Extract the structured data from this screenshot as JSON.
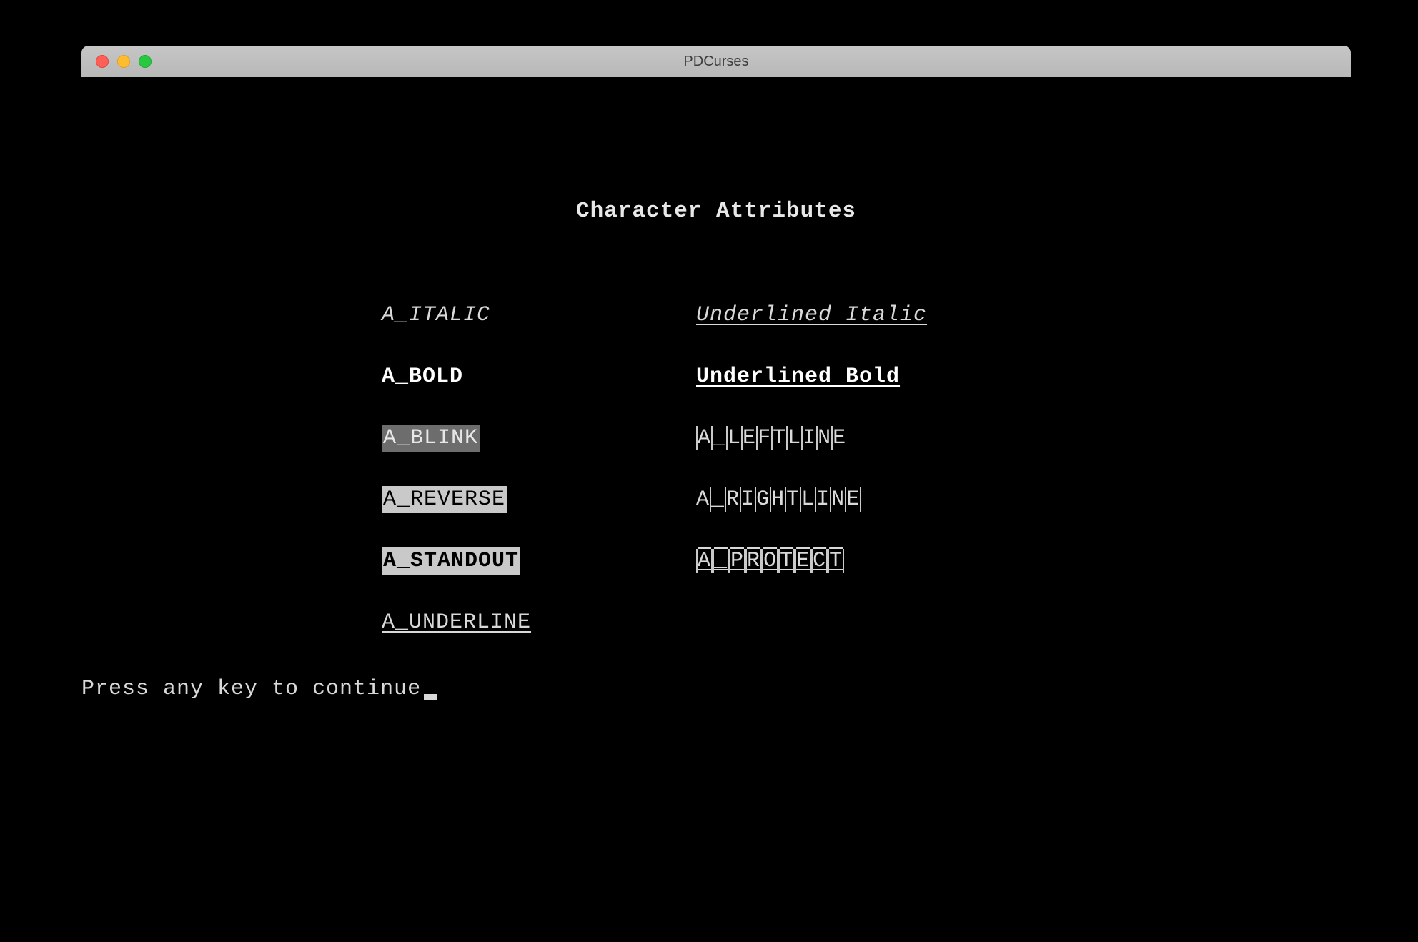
{
  "window": {
    "title": "PDCurses"
  },
  "heading": "Character Attributes",
  "attrs": {
    "italic": "A_ITALIC",
    "bold": "A_BOLD",
    "blink": "A_BLINK",
    "reverse": "A_REVERSE",
    "standout": "A_STANDOUT",
    "underline": "A_UNDERLINE",
    "und_italic": "Underlined Italic",
    "und_bold": "Underlined Bold",
    "leftline": "A_LEFTLINE",
    "rightline": "A_RIGHTLINE",
    "protect": "A_PROTECT"
  },
  "prompt": "Press any key to continue"
}
